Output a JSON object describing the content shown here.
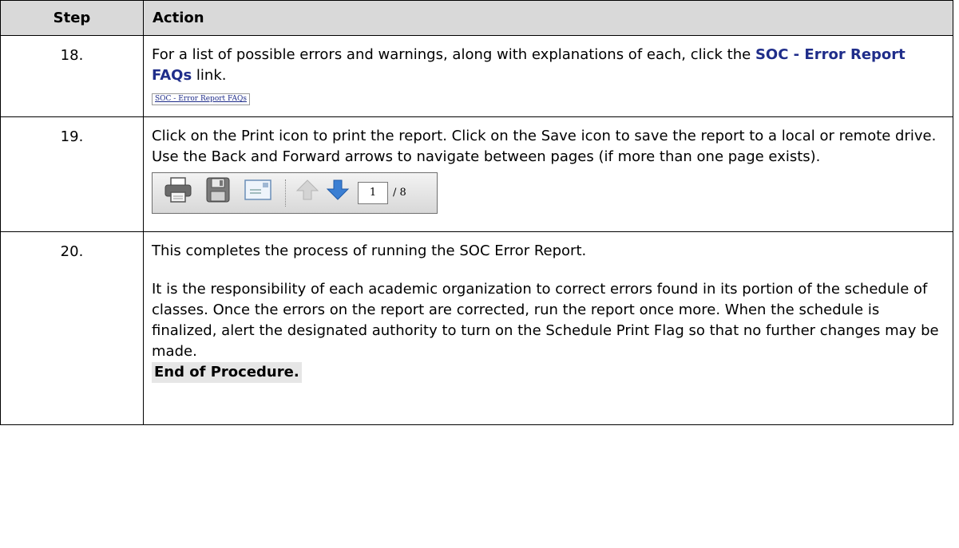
{
  "header": {
    "step": "Step",
    "action": "Action"
  },
  "rows": [
    {
      "step": "18.",
      "text_before": "For a list of possible errors and warnings, along with explanations of each, click the ",
      "link": "SOC - Error Report FAQs",
      "text_after": " link.",
      "screenshot_link": "SOC - Error Report FAQs"
    },
    {
      "step": "19.",
      "text": "Click on the Print icon to print the report.  Click on the Save icon to save the report to a local or remote drive.  Use the Back and Forward arrows to navigate between pages (if more than one page exists).",
      "toolbar": {
        "icons": [
          "print-icon",
          "save-icon",
          "email-icon",
          "previous-page-icon",
          "next-page-icon"
        ],
        "page_current": "1",
        "page_total": "/ 8"
      }
    },
    {
      "step": "20.",
      "text1": "This completes the process of running the SOC Error Report.",
      "text2": "It is the responsibility of each academic organization to correct errors found in its portion of the schedule of classes.  Once the errors on the report are corrected, run the report once more.  When the schedule is finalized, alert the designated authority to turn on the Schedule Print Flag so that no further changes may be made.",
      "end": "End of Procedure."
    }
  ],
  "colors": {
    "header_bg": "#d9d9d9",
    "link": "#1f2d8a",
    "arrow_blue": "#3b7fd3"
  }
}
